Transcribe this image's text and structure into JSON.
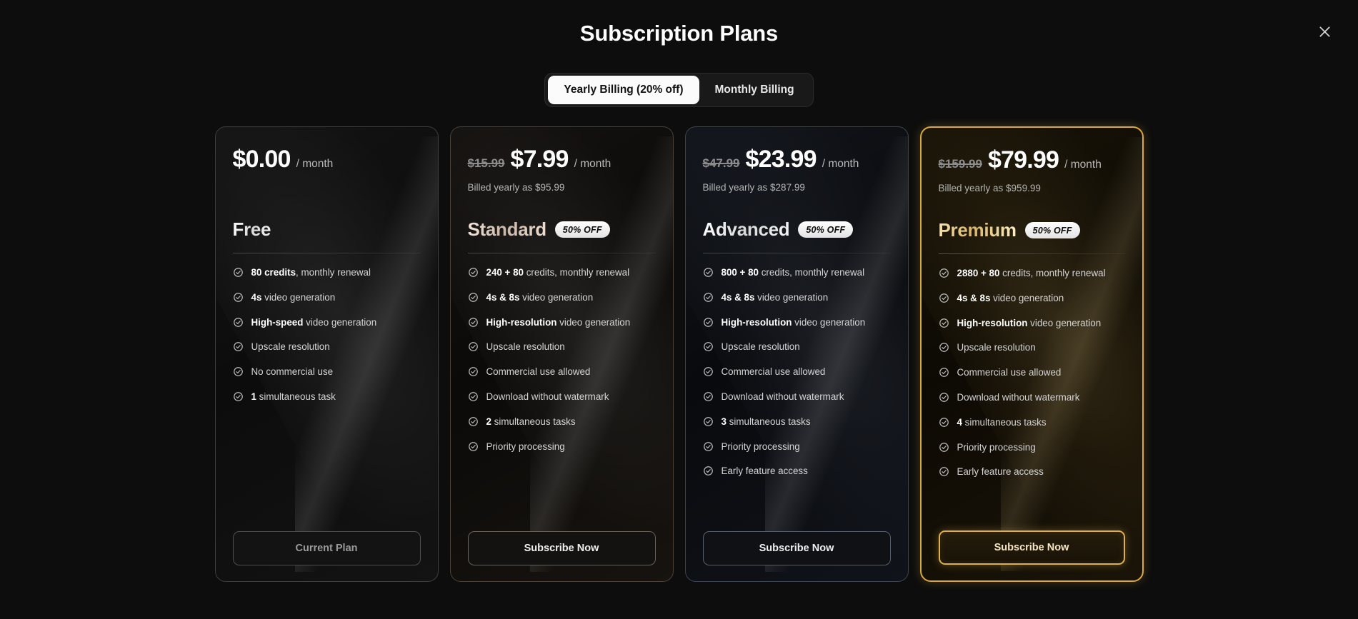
{
  "modal": {
    "title": "Subscription Plans",
    "close_icon": "close-icon"
  },
  "billing_toggle": {
    "options": [
      {
        "label": "Yearly Billing (20% off)",
        "active": true
      },
      {
        "label": "Monthly Billing",
        "active": false
      }
    ]
  },
  "plans": [
    {
      "id": "free",
      "name": "Free",
      "old_price": "",
      "price": "$0.00",
      "per": "/ month",
      "billed_note": "",
      "badge": "",
      "cta": "Current Plan",
      "cta_state": "disabled",
      "features": [
        {
          "bold": "80 credits",
          "rest": ", monthly renewal"
        },
        {
          "bold": "4s",
          "rest": " video generation"
        },
        {
          "bold": "High-speed",
          "rest": " video generation"
        },
        {
          "bold": "",
          "rest": "Upscale resolution"
        },
        {
          "bold": "",
          "rest": "No commercial use"
        },
        {
          "bold": "1",
          "rest": " simultaneous task"
        }
      ]
    },
    {
      "id": "standard",
      "name": "Standard",
      "old_price": "$15.99",
      "price": "$7.99",
      "per": "/ month",
      "billed_note": "Billed yearly as $95.99",
      "badge": "50% OFF",
      "cta": "Subscribe Now",
      "cta_state": "active",
      "features": [
        {
          "bold": "240 + 80",
          "rest": " credits, monthly renewal"
        },
        {
          "bold": "4s & 8s",
          "rest": " video generation"
        },
        {
          "bold": "High-resolution",
          "rest": " video generation"
        },
        {
          "bold": "",
          "rest": "Upscale resolution"
        },
        {
          "bold": "",
          "rest": "Commercial use allowed"
        },
        {
          "bold": "",
          "rest": "Download without watermark"
        },
        {
          "bold": "2",
          "rest": " simultaneous tasks"
        },
        {
          "bold": "",
          "rest": "Priority processing"
        }
      ]
    },
    {
      "id": "advanced",
      "name": "Advanced",
      "old_price": "$47.99",
      "price": "$23.99",
      "per": "/ month",
      "billed_note": "Billed yearly as $287.99",
      "badge": "50% OFF",
      "cta": "Subscribe Now",
      "cta_state": "active",
      "features": [
        {
          "bold": "800 + 80",
          "rest": " credits, monthly renewal"
        },
        {
          "bold": "4s & 8s",
          "rest": " video generation"
        },
        {
          "bold": "High-resolution",
          "rest": " video generation"
        },
        {
          "bold": "",
          "rest": "Upscale resolution"
        },
        {
          "bold": "",
          "rest": "Commercial use allowed"
        },
        {
          "bold": "",
          "rest": "Download without watermark"
        },
        {
          "bold": "3",
          "rest": " simultaneous tasks"
        },
        {
          "bold": "",
          "rest": "Priority processing"
        },
        {
          "bold": "",
          "rest": "Early feature access"
        }
      ]
    },
    {
      "id": "premium",
      "name": "Premium",
      "old_price": "$159.99",
      "price": "$79.99",
      "per": "/ month",
      "billed_note": "Billed yearly as $959.99",
      "badge": "50% OFF",
      "cta": "Subscribe Now",
      "cta_state": "highlighted",
      "features": [
        {
          "bold": "2880 + 80",
          "rest": " credits, monthly renewal"
        },
        {
          "bold": "4s & 8s",
          "rest": " video generation"
        },
        {
          "bold": "High-resolution",
          "rest": " video generation"
        },
        {
          "bold": "",
          "rest": "Upscale resolution"
        },
        {
          "bold": "",
          "rest": "Commercial use allowed"
        },
        {
          "bold": "",
          "rest": "Download without watermark"
        },
        {
          "bold": "4",
          "rest": " simultaneous tasks"
        },
        {
          "bold": "",
          "rest": "Priority processing"
        },
        {
          "bold": "",
          "rest": "Early feature access"
        }
      ]
    }
  ],
  "colors": {
    "background": "#0d0d0d",
    "gold_accent": "#d9a93c",
    "toggle_active_bg": "#fbfbfb",
    "text_primary": "#ffffff",
    "text_muted": "#b4b4b4"
  }
}
